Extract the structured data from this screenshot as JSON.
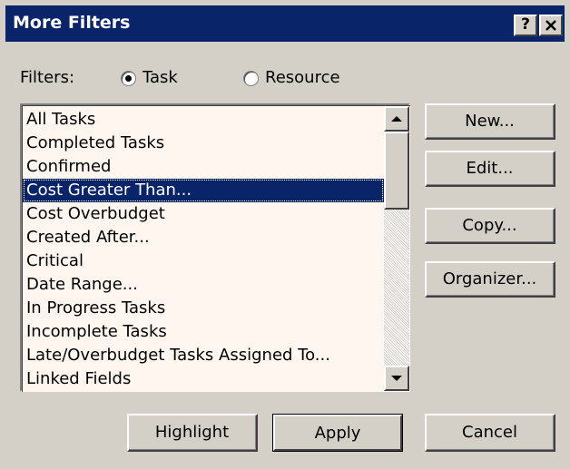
{
  "window": {
    "title": "More Filters",
    "help_btn": "?",
    "close_btn": "✕"
  },
  "filters": {
    "label": "Filters:",
    "options": [
      {
        "label": "Task",
        "selected": true
      },
      {
        "label": "Resource",
        "selected": false
      }
    ]
  },
  "list": {
    "items": [
      "All Tasks",
      "Completed Tasks",
      "Confirmed",
      "Cost Greater Than...",
      "Cost Overbudget",
      "Created After...",
      "Critical",
      "Date Range...",
      "In Progress Tasks",
      "Incomplete Tasks",
      "Late/Overbudget Tasks Assigned To...",
      "Linked Fields"
    ],
    "selected_index": 3
  },
  "side_buttons": {
    "new": "New...",
    "edit": "Edit...",
    "copy": "Copy...",
    "organizer": "Organizer..."
  },
  "bottom_buttons": {
    "highlight": "Highlight",
    "apply": "Apply",
    "cancel": "Cancel"
  },
  "colors": {
    "title_bg": "#0a246a",
    "selection_bg": "#0a246a",
    "face": "#d4d0c8",
    "list_bg": "#fff7ef"
  }
}
